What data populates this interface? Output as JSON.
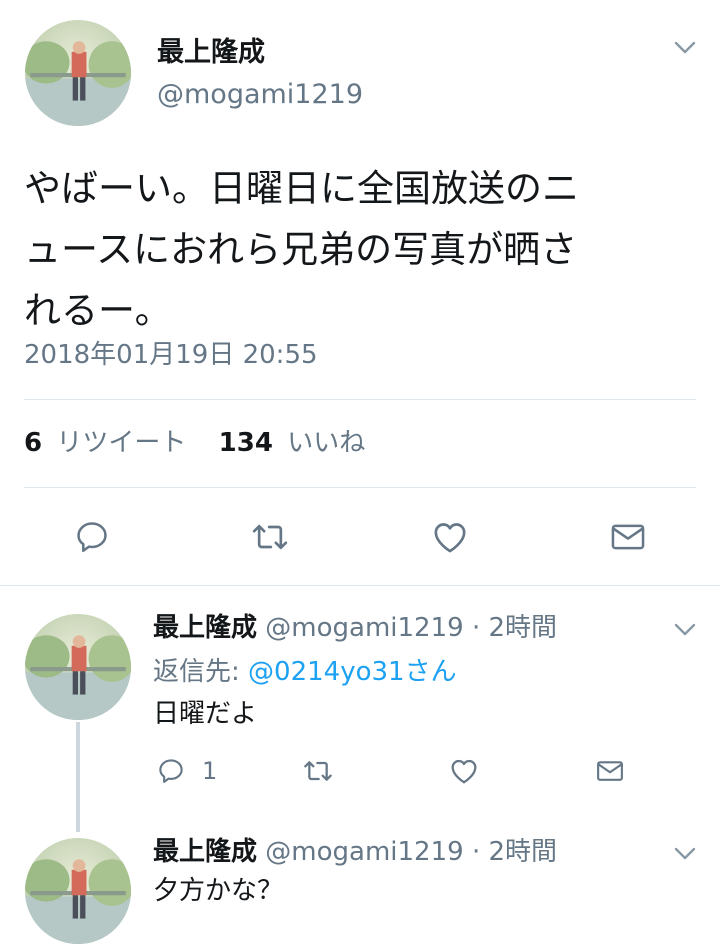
{
  "main_tweet": {
    "display_name": "最上隆成",
    "handle": "@mogami1219",
    "text_lines": [
      "やばーい。日曜日に全国放送のニ",
      "ュースにおれら兄弟の写真が晒さ",
      "れるー。"
    ],
    "timestamp": "2018年01月19日 20:55",
    "retweet_count": "6",
    "retweet_label": "リツイート",
    "like_count": "134",
    "like_label": "いいね"
  },
  "replies": [
    {
      "display_name": "最上隆成",
      "handle": "@mogami1219",
      "time": "· 2時間",
      "reply_to_prefix": "返信先: ",
      "reply_to_user": "@0214yo31さん",
      "text": "日曜だよ",
      "reply_count": "1"
    },
    {
      "display_name": "最上隆成",
      "handle": "@mogami1219",
      "time": "· 2時間",
      "text": "夕方かな？"
    }
  ],
  "icons": {
    "menu": "chevron-down-icon",
    "reply": "reply-icon",
    "retweet": "retweet-icon",
    "like": "heart-icon",
    "dm": "mail-icon"
  },
  "colors": {
    "icon_gray": "#657786",
    "link_blue": "#1da1f2",
    "divider": "#e1e8ed"
  }
}
